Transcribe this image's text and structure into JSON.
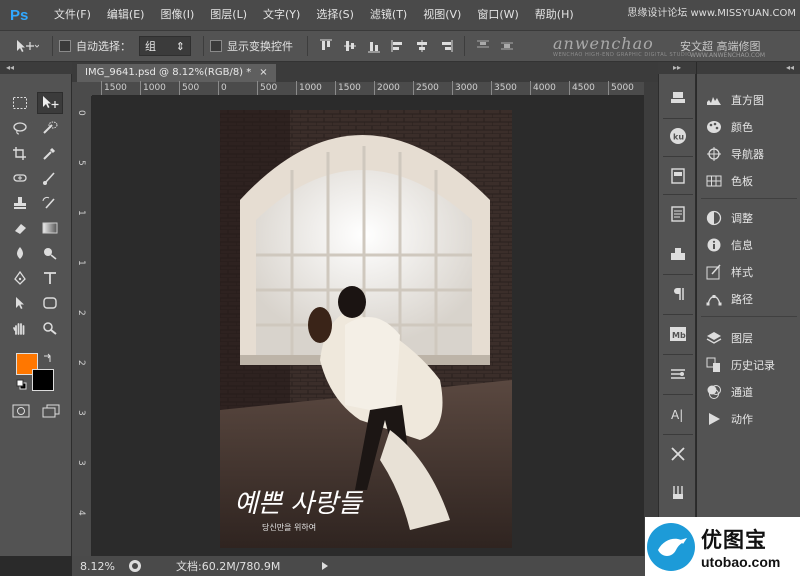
{
  "app": {
    "logo": "Ps"
  },
  "menu": [
    "文件(F)",
    "编辑(E)",
    "图像(I)",
    "图层(L)",
    "文字(Y)",
    "选择(S)",
    "滤镜(T)",
    "视图(V)",
    "窗口(W)",
    "帮助(H)"
  ],
  "top_watermark": "思缘设计论坛 www.MISSYUAN.COM",
  "options": {
    "tool_icon": "move-tool-icon",
    "auto_select_label": "自动选择：",
    "auto_select_value": "组",
    "show_transform_label": "显示变换控件"
  },
  "brand": {
    "script": "anwenchao",
    "name": "安文超 高端修图",
    "small": "WENCHAO HIGH-END GRAPHIC DIGITAL STUDIO",
    "url": "WWW.ANWENCHAO.COM"
  },
  "collapse_left": "◂◂",
  "collapse_mid": "▸▸",
  "collapse_right": "◂◂",
  "document": {
    "tab_title": "IMG_9641.psd @ 8.12%(RGB/8) *",
    "close": "×"
  },
  "ruler": {
    "top": [
      "1500",
      "1000",
      "500",
      "0",
      "500",
      "1000",
      "1500",
      "2000",
      "2500",
      "3000",
      "3500",
      "4000",
      "4500",
      "5000"
    ],
    "left": [
      "0",
      "5",
      "1",
      "1",
      "2",
      "2",
      "3",
      "3",
      "4"
    ]
  },
  "photo": {
    "colors": {
      "wall": "#3a2c27",
      "window": "#f4f4f0",
      "floor": "#4a3a33",
      "arch": "#e8e2d8"
    },
    "text_main": "예쁜 사랑들",
    "text_sub": "당신만을 위하여"
  },
  "status": {
    "zoom": "8.12%",
    "doc": "文档:60.2M/780.9M"
  },
  "panels": [
    {
      "icon": "histogram-icon",
      "label": "直方图"
    },
    {
      "icon": "palette-icon",
      "label": "颜色"
    },
    {
      "icon": "navigator-icon",
      "label": "导航器"
    },
    {
      "icon": "swatches-icon",
      "label": "色板"
    },
    {
      "icon": "adjustments-icon",
      "label": "调整"
    },
    {
      "icon": "info-icon",
      "label": "信息"
    },
    {
      "icon": "styles-icon",
      "label": "样式"
    },
    {
      "icon": "paths-icon",
      "label": "路径"
    },
    {
      "icon": "layers-icon",
      "label": "图层"
    },
    {
      "icon": "history-icon",
      "label": "历史记录"
    },
    {
      "icon": "channels-icon",
      "label": "通道"
    },
    {
      "icon": "actions-icon",
      "label": "动作"
    }
  ],
  "iconcol_labels": {
    "ku": "ku",
    "mb": "Mb",
    "ai": "A|"
  },
  "footer_watermark": {
    "cn": "优图宝",
    "en": "utobao.com"
  },
  "accent": {
    "foreground": "#ff7700",
    "background": "#000000"
  }
}
